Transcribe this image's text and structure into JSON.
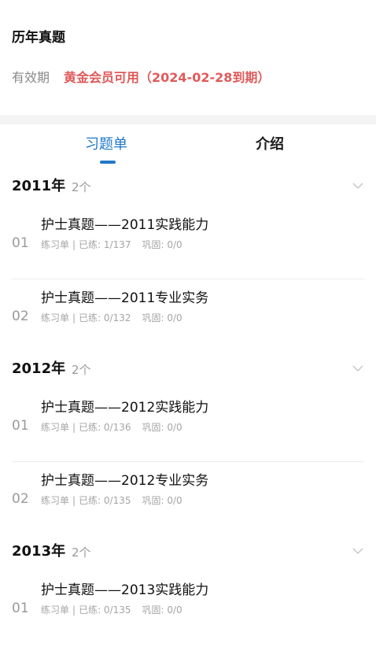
{
  "header": {
    "title": "历年真题",
    "validity_label": "有效期",
    "validity_value": "黄金会员可用（2024-02-28到期）"
  },
  "tabs": [
    {
      "label": "习题单",
      "active": true
    },
    {
      "label": "介绍",
      "active": false
    }
  ],
  "colors": {
    "accent": "#1f78c8",
    "validity": "#e05a5a",
    "muted": "#9a9a9a"
  },
  "groups": [
    {
      "year": "2011年",
      "count": "2个",
      "items": [
        {
          "index": "01",
          "title": "护士真题——2011实践能力",
          "type": "练习单",
          "practiced": "已练: 1/137",
          "consolidated": "巩固: 0/0"
        },
        {
          "index": "02",
          "title": "护士真题——2011专业实务",
          "type": "练习单",
          "practiced": "已练: 0/132",
          "consolidated": "巩固: 0/0"
        }
      ]
    },
    {
      "year": "2012年",
      "count": "2个",
      "items": [
        {
          "index": "01",
          "title": "护士真题——2012实践能力",
          "type": "练习单",
          "practiced": "已练: 0/136",
          "consolidated": "巩固: 0/0"
        },
        {
          "index": "02",
          "title": "护士真题——2012专业实务",
          "type": "练习单",
          "practiced": "已练: 0/135",
          "consolidated": "巩固: 0/0"
        }
      ]
    },
    {
      "year": "2013年",
      "count": "2个",
      "items": [
        {
          "index": "01",
          "title": "护士真题——2013实践能力",
          "type": "练习单",
          "practiced": "已练: 0/135",
          "consolidated": "巩固: 0/0"
        }
      ]
    }
  ],
  "icons": {
    "group_toggle": "chevron-down-icon"
  }
}
